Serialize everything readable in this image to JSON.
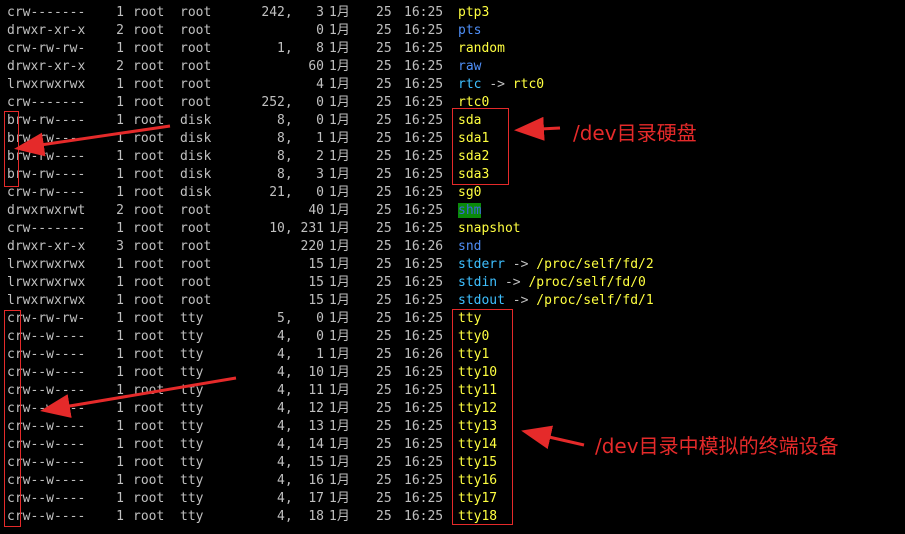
{
  "terminal": {
    "rows": [
      {
        "perms": "crw-------",
        "links": "1",
        "owner": "root",
        "group": "root",
        "size": "242,   3",
        "month": "1月",
        "day": "25",
        "time": "16:25",
        "name": "ptp3",
        "type": "dev"
      },
      {
        "perms": "drwxr-xr-x",
        "links": "2",
        "owner": "root",
        "group": "root",
        "size": "0",
        "month": "1月",
        "day": "25",
        "time": "16:25",
        "name": "pts",
        "type": "dir"
      },
      {
        "perms": "crw-rw-rw-",
        "links": "1",
        "owner": "root",
        "group": "root",
        "size": "1,   8",
        "month": "1月",
        "day": "25",
        "time": "16:25",
        "name": "random",
        "type": "dev"
      },
      {
        "perms": "drwxr-xr-x",
        "links": "2",
        "owner": "root",
        "group": "root",
        "size": "60",
        "month": "1月",
        "day": "25",
        "time": "16:25",
        "name": "raw",
        "type": "dir"
      },
      {
        "perms": "lrwxrwxrwx",
        "links": "1",
        "owner": "root",
        "group": "root",
        "size": "4",
        "month": "1月",
        "day": "25",
        "time": "16:25",
        "name": "rtc",
        "arrow": "->",
        "target": "rtc0",
        "type": "link"
      },
      {
        "perms": "crw-------",
        "links": "1",
        "owner": "root",
        "group": "root",
        "size": "252,   0",
        "month": "1月",
        "day": "25",
        "time": "16:25",
        "name": "rtc0",
        "type": "dev"
      },
      {
        "perms": "brw-rw----",
        "links": "1",
        "owner": "root",
        "group": "disk",
        "size": "8,   0",
        "month": "1月",
        "day": "25",
        "time": "16:25",
        "name": "sda",
        "type": "dev"
      },
      {
        "perms": "brw-rw----",
        "links": "1",
        "owner": "root",
        "group": "disk",
        "size": "8,   1",
        "month": "1月",
        "day": "25",
        "time": "16:25",
        "name": "sda1",
        "type": "dev"
      },
      {
        "perms": "brw-rw----",
        "links": "1",
        "owner": "root",
        "group": "disk",
        "size": "8,   2",
        "month": "1月",
        "day": "25",
        "time": "16:25",
        "name": "sda2",
        "type": "dev"
      },
      {
        "perms": "brw-rw----",
        "links": "1",
        "owner": "root",
        "group": "disk",
        "size": "8,   3",
        "month": "1月",
        "day": "25",
        "time": "16:25",
        "name": "sda3",
        "type": "dev"
      },
      {
        "perms": "crw-rw----",
        "links": "1",
        "owner": "root",
        "group": "disk",
        "size": "21,   0",
        "month": "1月",
        "day": "25",
        "time": "16:25",
        "name": "sg0",
        "type": "dev"
      },
      {
        "perms": "drwxrwxrwt",
        "links": "2",
        "owner": "root",
        "group": "root",
        "size": "40",
        "month": "1月",
        "day": "25",
        "time": "16:25",
        "name": "shm",
        "type": "shm"
      },
      {
        "perms": "crw-------",
        "links": "1",
        "owner": "root",
        "group": "root",
        "size": "10, 231",
        "month": "1月",
        "day": "25",
        "time": "16:25",
        "name": "snapshot",
        "type": "dev"
      },
      {
        "perms": "drwxr-xr-x",
        "links": "3",
        "owner": "root",
        "group": "root",
        "size": "220",
        "month": "1月",
        "day": "25",
        "time": "16:26",
        "name": "snd",
        "type": "dir"
      },
      {
        "perms": "lrwxrwxrwx",
        "links": "1",
        "owner": "root",
        "group": "root",
        "size": "15",
        "month": "1月",
        "day": "25",
        "time": "16:25",
        "name": "stderr",
        "arrow": "->",
        "target": "/proc/self/fd/2",
        "type": "link"
      },
      {
        "perms": "lrwxrwxrwx",
        "links": "1",
        "owner": "root",
        "group": "root",
        "size": "15",
        "month": "1月",
        "day": "25",
        "time": "16:25",
        "name": "stdin",
        "arrow": "->",
        "target": "/proc/self/fd/0",
        "type": "link"
      },
      {
        "perms": "lrwxrwxrwx",
        "links": "1",
        "owner": "root",
        "group": "root",
        "size": "15",
        "month": "1月",
        "day": "25",
        "time": "16:25",
        "name": "stdout",
        "arrow": "->",
        "target": "/proc/self/fd/1",
        "type": "link"
      },
      {
        "perms": "crw-rw-rw-",
        "links": "1",
        "owner": "root",
        "group": "tty",
        "size": "5,   0",
        "month": "1月",
        "day": "25",
        "time": "16:25",
        "name": "tty",
        "type": "dev"
      },
      {
        "perms": "crw--w----",
        "links": "1",
        "owner": "root",
        "group": "tty",
        "size": "4,   0",
        "month": "1月",
        "day": "25",
        "time": "16:25",
        "name": "tty0",
        "type": "dev"
      },
      {
        "perms": "crw--w----",
        "links": "1",
        "owner": "root",
        "group": "tty",
        "size": "4,   1",
        "month": "1月",
        "day": "25",
        "time": "16:26",
        "name": "tty1",
        "type": "dev"
      },
      {
        "perms": "crw--w----",
        "links": "1",
        "owner": "root",
        "group": "tty",
        "size": "4,  10",
        "month": "1月",
        "day": "25",
        "time": "16:25",
        "name": "tty10",
        "type": "dev"
      },
      {
        "perms": "crw--w----",
        "links": "1",
        "owner": "root",
        "group": "tty",
        "size": "4,  11",
        "month": "1月",
        "day": "25",
        "time": "16:25",
        "name": "tty11",
        "type": "dev"
      },
      {
        "perms": "crw--w----",
        "links": "1",
        "owner": "root",
        "group": "tty",
        "size": "4,  12",
        "month": "1月",
        "day": "25",
        "time": "16:25",
        "name": "tty12",
        "type": "dev"
      },
      {
        "perms": "crw--w----",
        "links": "1",
        "owner": "root",
        "group": "tty",
        "size": "4,  13",
        "month": "1月",
        "day": "25",
        "time": "16:25",
        "name": "tty13",
        "type": "dev"
      },
      {
        "perms": "crw--w----",
        "links": "1",
        "owner": "root",
        "group": "tty",
        "size": "4,  14",
        "month": "1月",
        "day": "25",
        "time": "16:25",
        "name": "tty14",
        "type": "dev"
      },
      {
        "perms": "crw--w----",
        "links": "1",
        "owner": "root",
        "group": "tty",
        "size": "4,  15",
        "month": "1月",
        "day": "25",
        "time": "16:25",
        "name": "tty15",
        "type": "dev"
      },
      {
        "perms": "crw--w----",
        "links": "1",
        "owner": "root",
        "group": "tty",
        "size": "4,  16",
        "month": "1月",
        "day": "25",
        "time": "16:25",
        "name": "tty16",
        "type": "dev"
      },
      {
        "perms": "crw--w----",
        "links": "1",
        "owner": "root",
        "group": "tty",
        "size": "4,  17",
        "month": "1月",
        "day": "25",
        "time": "16:25",
        "name": "tty17",
        "type": "dev"
      },
      {
        "perms": "crw--w----",
        "links": "1",
        "owner": "root",
        "group": "tty",
        "size": "4,  18",
        "month": "1月",
        "day": "25",
        "time": "16:25",
        "name": "tty18",
        "type": "dev"
      }
    ]
  },
  "annotations": {
    "disk_note": "/dev目录硬盘",
    "tty_note": "/dev目录中模拟的终端设备",
    "color": "#e52a2a"
  }
}
